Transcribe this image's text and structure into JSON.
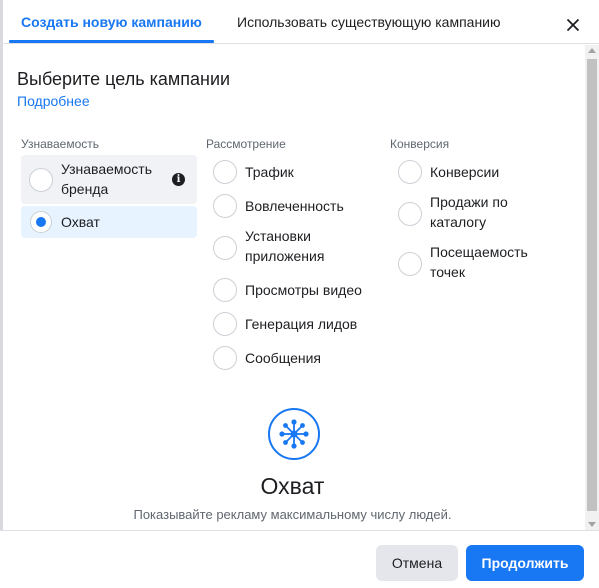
{
  "tabs": {
    "create_label": "Создать новую кампанию",
    "existing_label": "Использовать существующую кампанию"
  },
  "heading": "Выберите цель кампании",
  "learn_more": "Подробнее",
  "columns": {
    "awareness": {
      "title": "Узнаваемость",
      "options": [
        {
          "label_line1": "Узнаваемость",
          "label_line2": "бренда",
          "selected": false,
          "has_info_icon": true
        },
        {
          "label": "Охват",
          "selected": true
        }
      ]
    },
    "consideration": {
      "title": "Рассмотрение",
      "options": [
        {
          "label": "Трафик"
        },
        {
          "label": "Вовлеченность"
        },
        {
          "label_line1": "Установки",
          "label_line2": "приложения"
        },
        {
          "label": "Просмотры видео"
        },
        {
          "label": "Генерация лидов"
        },
        {
          "label": "Сообщения"
        }
      ]
    },
    "conversion": {
      "title": "Конверсия",
      "options": [
        {
          "label": "Конверсии"
        },
        {
          "label_line1": "Продажи по",
          "label_line2": "каталогу"
        },
        {
          "label_line1": "Посещаемость",
          "label_line2": "точек"
        }
      ]
    }
  },
  "preview": {
    "icon": "reach-network-icon",
    "title": "Охват",
    "description": "Показывайте рекламу максимальному числу людей."
  },
  "footer": {
    "cancel_label": "Отмена",
    "continue_label": "Продолжить"
  },
  "colors": {
    "accent": "#1877f2",
    "selected_bg": "#e7f3ff",
    "hover_bg": "#f0f2f5"
  }
}
